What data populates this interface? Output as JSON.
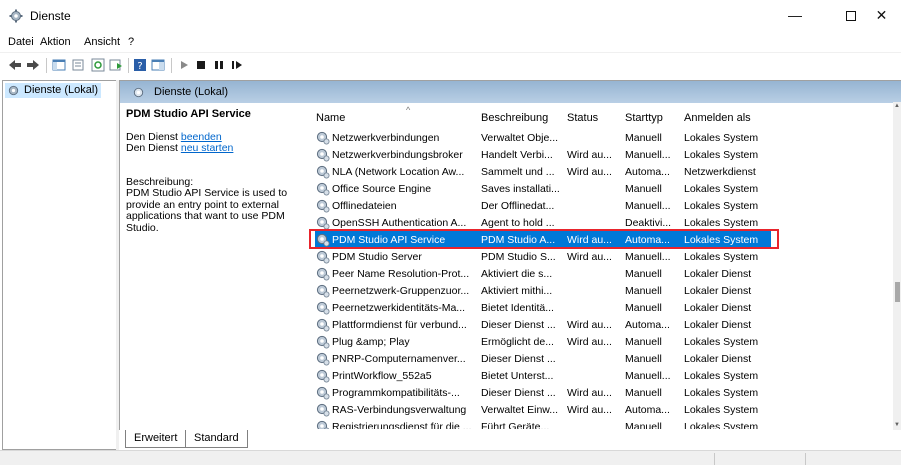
{
  "window": {
    "title": "Dienste"
  },
  "menu": [
    "Datei",
    "Aktion",
    "Ansicht",
    "?"
  ],
  "tree": {
    "item": "Dienste (Lokal)"
  },
  "pane_header": "Dienste (Lokal)",
  "description": {
    "service_name": "PDM Studio API Service",
    "stop_prefix": "Den Dienst ",
    "stop_link": "beenden",
    "restart_prefix": "Den Dienst ",
    "restart_link": "neu starten",
    "label": "Beschreibung:",
    "text": "PDM Studio API Service is used to provide an entry point to external applications that want to use PDM Studio."
  },
  "columns": {
    "name": "Name",
    "beschreibung": "Beschreibung",
    "status": "Status",
    "starttyp": "Starttyp",
    "anmelden": "Anmelden als"
  },
  "services": [
    {
      "name": "Netzwerkverbindungen",
      "beschreibung": "Verwaltet Obje...",
      "status": "",
      "starttyp": "Manuell",
      "anmelden": "Lokales System"
    },
    {
      "name": "Netzwerkverbindungsbroker",
      "beschreibung": "Handelt Verbi...",
      "status": "Wird au...",
      "starttyp": "Manuell...",
      "anmelden": "Lokales System"
    },
    {
      "name": "NLA (Network Location Aw...",
      "beschreibung": "Sammelt und ...",
      "status": "Wird au...",
      "starttyp": "Automa...",
      "anmelden": "Netzwerkdienst"
    },
    {
      "name": "Office  Source Engine",
      "beschreibung": "Saves installati...",
      "status": "",
      "starttyp": "Manuell",
      "anmelden": "Lokales System"
    },
    {
      "name": "Offlinedateien",
      "beschreibung": "Der Offlinedat...",
      "status": "",
      "starttyp": "Manuell...",
      "anmelden": "Lokales System"
    },
    {
      "name": "OpenSSH Authentication A...",
      "beschreibung": "Agent to hold ...",
      "status": "",
      "starttyp": "Deaktivi...",
      "anmelden": "Lokales System"
    },
    {
      "name": "PDM Studio API Service",
      "beschreibung": "PDM Studio A...",
      "status": "Wird au...",
      "starttyp": "Automa...",
      "anmelden": "Lokales System",
      "selected": true
    },
    {
      "name": "PDM Studio Server",
      "beschreibung": "PDM Studio S...",
      "status": "Wird au...",
      "starttyp": "Manuell...",
      "anmelden": "Lokales System"
    },
    {
      "name": "Peer Name Resolution-Prot...",
      "beschreibung": "Aktiviert die s...",
      "status": "",
      "starttyp": "Manuell",
      "anmelden": "Lokaler Dienst"
    },
    {
      "name": "Peernetzwerk-Gruppenzuor...",
      "beschreibung": "Aktiviert mithi...",
      "status": "",
      "starttyp": "Manuell",
      "anmelden": "Lokaler Dienst"
    },
    {
      "name": "Peernetzwerkidentitäts-Ma...",
      "beschreibung": "Bietet Identitä...",
      "status": "",
      "starttyp": "Manuell",
      "anmelden": "Lokaler Dienst"
    },
    {
      "name": "Plattformdienst für verbund...",
      "beschreibung": "Dieser Dienst ...",
      "status": "Wird au...",
      "starttyp": "Automa...",
      "anmelden": "Lokaler Dienst"
    },
    {
      "name": "Plug &amp; Play",
      "beschreibung": "Ermöglicht de...",
      "status": "Wird au...",
      "starttyp": "Manuell",
      "anmelden": "Lokales System"
    },
    {
      "name": "PNRP-Computernamenver...",
      "beschreibung": "Dieser Dienst ...",
      "status": "",
      "starttyp": "Manuell",
      "anmelden": "Lokaler Dienst"
    },
    {
      "name": "PrintWorkflow_552a5",
      "beschreibung": "Bietet Unterst...",
      "status": "",
      "starttyp": "Manuell...",
      "anmelden": "Lokales System"
    },
    {
      "name": "Programmkompatibilitäts-...",
      "beschreibung": "Dieser Dienst ...",
      "status": "Wird au...",
      "starttyp": "Manuell",
      "anmelden": "Lokales System"
    },
    {
      "name": "RAS-Verbindungsverwaltung",
      "beschreibung": "Verwaltet Einw...",
      "status": "Wird au...",
      "starttyp": "Automa...",
      "anmelden": "Lokales System"
    },
    {
      "name": "Registrierungsdienst für die ...",
      "beschreibung": "Führt Geräte...",
      "status": "",
      "starttyp": "Manuell",
      "anmelden": "Lokales System"
    }
  ],
  "tabs": [
    "Erweitert",
    "Standard"
  ],
  "colors": {
    "selection": "#0078d7",
    "highlight_border": "#e8242c",
    "header_gradient": "#96b4d2"
  }
}
